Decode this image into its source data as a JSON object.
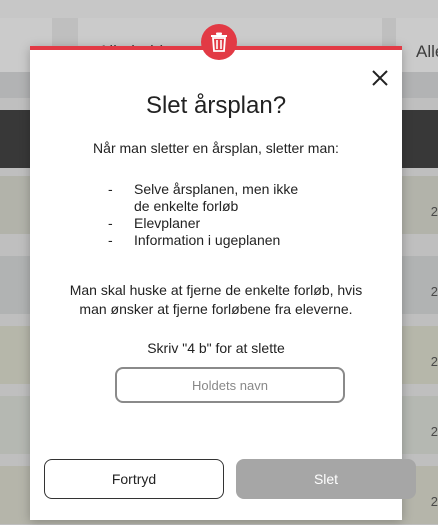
{
  "background": {
    "dropdowns": [
      {
        "label": "Alle hold"
      },
      {
        "label": "Alle"
      }
    ],
    "row_cutoff_texts": [
      "2",
      "2",
      "2",
      "2",
      "2"
    ]
  },
  "modal": {
    "title": "Slet årsplan?",
    "intro": "Når man sletter en årsplan, sletter man:",
    "bullets": [
      {
        "line1": "Selve årsplanen, men ikke",
        "line2": "de enkelte forløb"
      },
      {
        "line1": "Elevplaner",
        "line2": ""
      },
      {
        "line1": "Information i ugeplanen",
        "line2": ""
      }
    ],
    "bullet_marker": "-",
    "note": "Man skal huske at fjerne de enkelte forløb, hvis man ønsker at fjerne forløbene fra eleverne.",
    "instruction": "Skriv \"4 b\" for at slette",
    "input": {
      "placeholder": "Holdets navn",
      "value": ""
    },
    "cancel_label": "Fortryd",
    "delete_label": "Slet",
    "accent_color": "#e23a45",
    "delete_disabled_color": "#a6a6a6"
  },
  "icons": {
    "badge": "trash-icon",
    "close": "close-icon"
  }
}
